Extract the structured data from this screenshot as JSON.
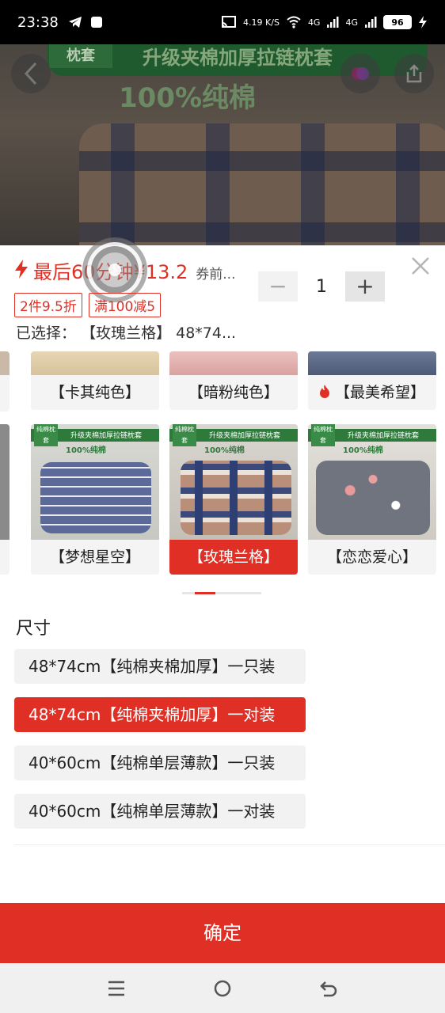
{
  "status_bar": {
    "time": "23:38",
    "net_speed": "4.19 K/S",
    "net_type_1": "4G",
    "net_type_2": "4G",
    "battery": "96"
  },
  "product_image": {
    "banner_tag": "枕套",
    "banner_text": "升级夹棉加厚拉链枕套",
    "banner_sub": "100%纯棉"
  },
  "sheet": {
    "countdown": "最后60分钟",
    "price": "¥13.2",
    "coupon_note": "券前...",
    "quantity": "1",
    "promo_tags": [
      "2件9.5折",
      "满100减5"
    ],
    "selected_label": "已选择：",
    "selected_value": "【玫瑰兰格】 48*74..."
  },
  "variants": {
    "row1": [
      "【卡其纯色】",
      "【暗粉纯色】",
      "【最美希望】"
    ],
    "row2": [
      "【梦想星空】",
      "【玫瑰兰格】",
      "【恋恋爱心】"
    ],
    "thumb_tag": "纯棉枕套",
    "thumb_banner": "升级夹棉加厚拉链枕套",
    "thumb_sub": "100%纯棉"
  },
  "size": {
    "title": "尺寸",
    "options": [
      "48*74cm【纯棉夹棉加厚】一只装",
      "48*74cm【纯棉夹棉加厚】一对装",
      "40*60cm【纯棉单层薄款】一只装",
      "40*60cm【纯棉单层薄款】一对装"
    ],
    "selected_index": 1
  },
  "confirm_label": "确定",
  "colors": {
    "accent": "#e03026"
  }
}
